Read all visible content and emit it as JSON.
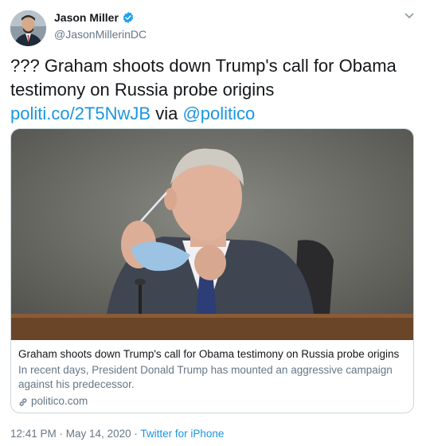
{
  "author": {
    "display_name": "Jason Miller",
    "handle": "@JasonMillerinDC",
    "verified": true
  },
  "tweet": {
    "text_prefix": "??? Graham shoots down Trump's call for Obama testimony on Russia probe origins ",
    "link_text": "politi.co/2T5NwJB",
    "text_middle": " via ",
    "mention_text": "@politico"
  },
  "card": {
    "title": "Graham shoots down Trump's call for Obama testimony on Russia probe origins",
    "description": "In recent days, President Donald Trump has mounted an aggressive campaign against his predecessor.",
    "domain": "politico.com"
  },
  "meta": {
    "time": "12:41 PM",
    "separator_1": " · ",
    "date": "May 14, 2020",
    "separator_2": " · ",
    "source": "Twitter for iPhone"
  },
  "colors": {
    "link": "#1b95e0",
    "secondary_text": "#657786",
    "verified": "#1da1f2"
  },
  "icons": {
    "verified": "verified-badge-icon",
    "caret": "chevron-down-icon",
    "link": "link-icon"
  }
}
